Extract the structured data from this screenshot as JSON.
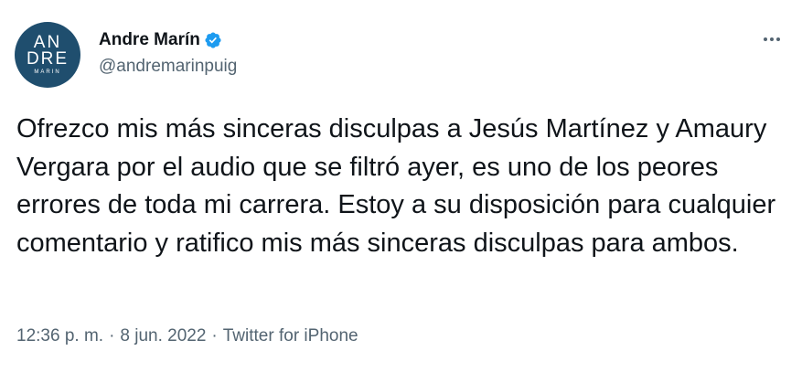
{
  "author": {
    "name": "Andre Marín",
    "handle": "@andremarinpuig",
    "avatar": {
      "line1": "AN",
      "line2": "DRE",
      "line3": "MARIN",
      "bg_color": "#1f4e6e"
    },
    "verified": true,
    "verified_color": "#1d9bf0"
  },
  "tweet": {
    "text": "Ofrezco mis más sinceras disculpas a Jesús Martínez y Amaury Vergara por el audio que se filtró ayer, es uno de los peores errores de toda mi carrera. Estoy a su disposición para cualquier comentario y ratifico mis más sinceras disculpas para ambos.",
    "time": "12:36 p. m.",
    "date": "8 jun. 2022",
    "source": "Twitter for iPhone",
    "separator": "·"
  },
  "icons": {
    "verified": "verified-badge-icon",
    "more": "more-options-icon"
  },
  "colors": {
    "text_primary": "#0f1419",
    "text_secondary": "#536471"
  }
}
